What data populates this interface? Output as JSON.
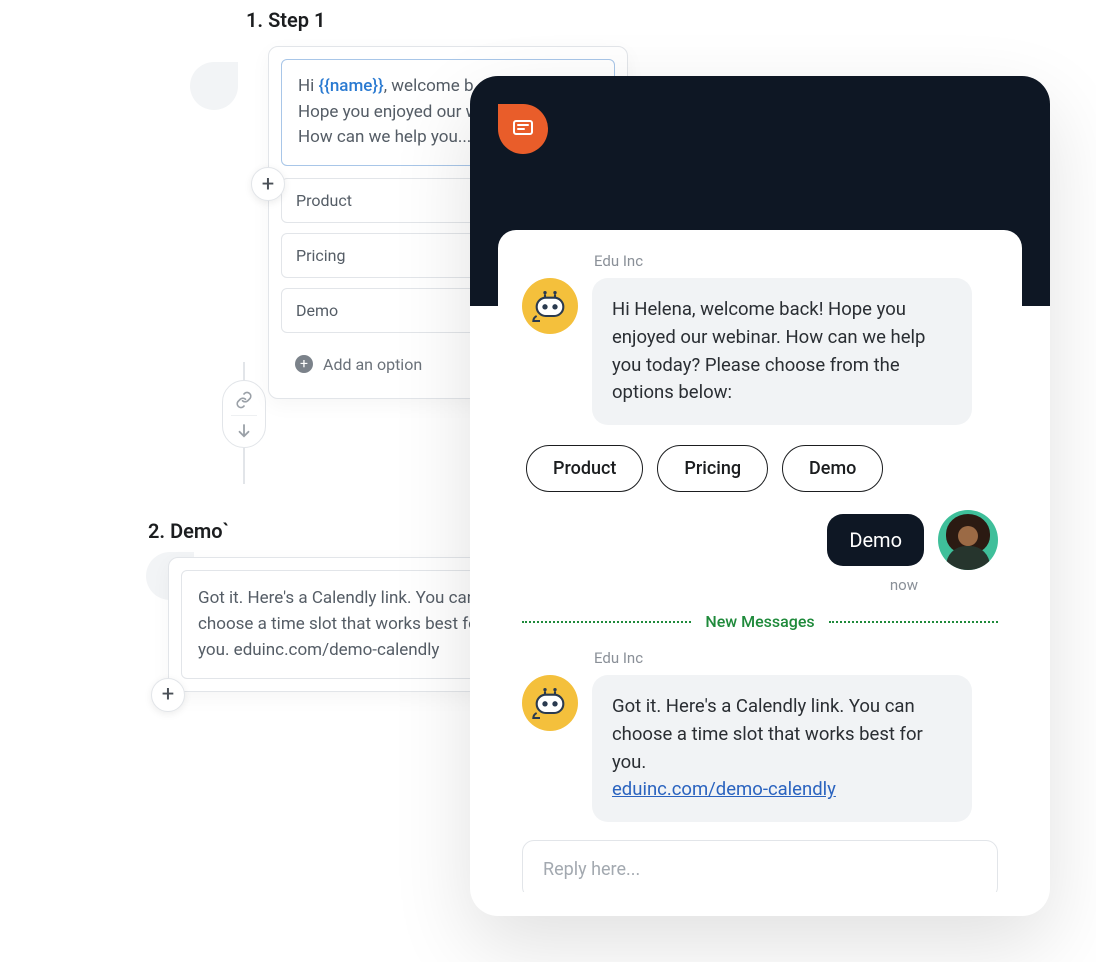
{
  "flow": {
    "step1": {
      "title": "1.  Step 1",
      "message_prefix": "Hi ",
      "variable": "{{name}}",
      "message_line1_suffix": ", welcome b",
      "message_line2": "Hope you enjoyed our w",
      "message_line3": "How can we help you...",
      "options": [
        "Product",
        "Pricing",
        "Demo"
      ],
      "add_option_label": "Add an option"
    },
    "step2": {
      "title": "2. Demo`",
      "message": "Got it. Here's a Calendly link. You can choose a time slot that works best for you. eduinc.com/demo-calendly"
    }
  },
  "chat": {
    "sender": "Edu Inc",
    "greeting": "Hi Helena, welcome back! Hope you enjoyed our webinar. How can we help you today? Please choose from the options below:",
    "options": [
      "Product",
      "Pricing",
      "Demo"
    ],
    "user_reply": "Demo",
    "timestamp": "now",
    "new_messages_label": "New Messages",
    "followup_text": "Got it. Here's a Calendly link. You can choose a time slot that works best for you.",
    "followup_link": "eduinc.com/demo-calendly",
    "reply_placeholder": "Reply here..."
  }
}
